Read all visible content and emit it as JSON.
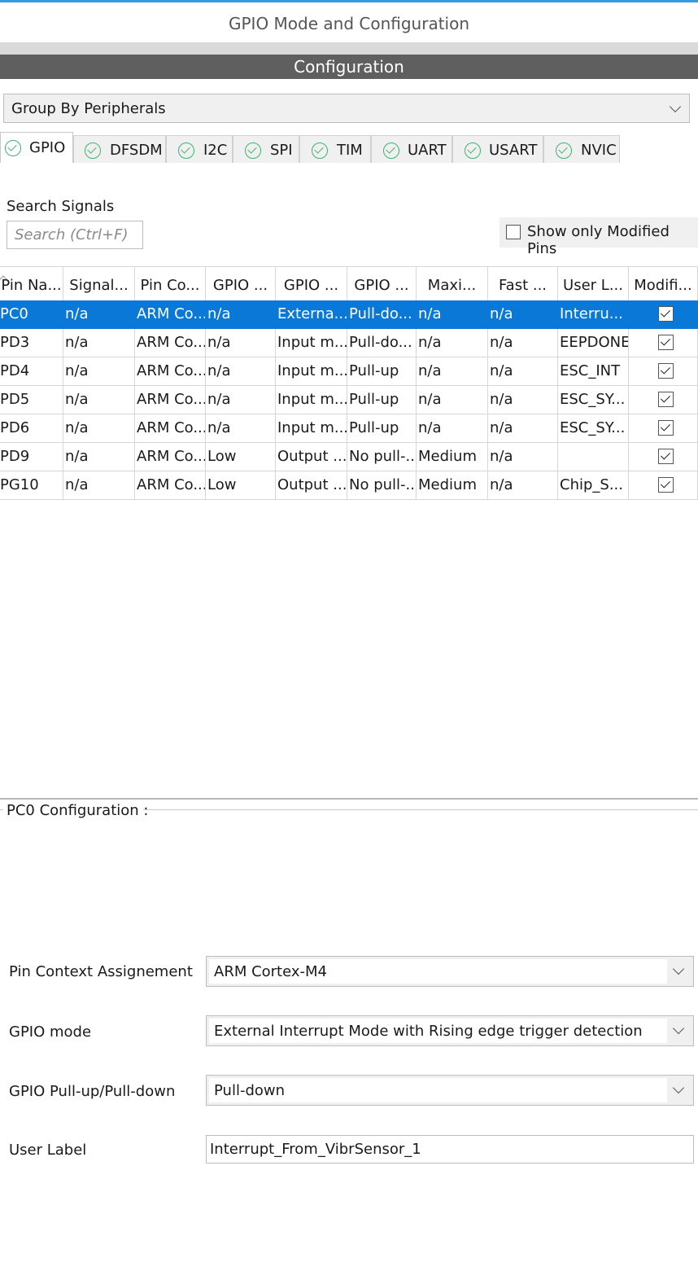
{
  "window": {
    "title": "GPIO Mode and Configuration"
  },
  "section": {
    "title": "Configuration"
  },
  "group_select": {
    "value": "Group By Peripherals"
  },
  "tabs": [
    {
      "label": "GPIO",
      "active": true,
      "icon": "check-circle-icon"
    },
    {
      "label": "DFSDM",
      "active": false,
      "icon": "check-circle-icon"
    },
    {
      "label": "I2C",
      "active": false,
      "icon": "check-circle-icon"
    },
    {
      "label": "SPI",
      "active": false,
      "icon": "check-circle-icon"
    },
    {
      "label": "TIM",
      "active": false,
      "icon": "check-circle-icon"
    },
    {
      "label": "UART",
      "active": false,
      "icon": "check-circle-icon"
    },
    {
      "label": "USART",
      "active": false,
      "icon": "check-circle-icon"
    },
    {
      "label": "NVIC",
      "active": false,
      "icon": "check-circle-icon"
    }
  ],
  "search": {
    "label": "Search Signals",
    "placeholder": "Search (Ctrl+F)",
    "value": ""
  },
  "modified_filter": {
    "label": "Show only Modified Pins",
    "checked": false
  },
  "table": {
    "columns": [
      "Pin Na...",
      "Signal...",
      "Pin Co...",
      "GPIO ...",
      "GPIO ...",
      "GPIO ...",
      "Maxi...",
      "Fast ...",
      "User L...",
      "Modifi..."
    ],
    "rows": [
      {
        "selected": true,
        "cells": [
          "PC0",
          "n/a",
          "ARM Co...",
          "n/a",
          "Externa...",
          "Pull-do...",
          "n/a",
          "n/a",
          "Interru..."
        ],
        "modified": true
      },
      {
        "selected": false,
        "cells": [
          "PD3",
          "n/a",
          "ARM Co...",
          "n/a",
          "Input m...",
          "Pull-do...",
          "n/a",
          "n/a",
          "EEPDONE"
        ],
        "modified": true
      },
      {
        "selected": false,
        "cells": [
          "PD4",
          "n/a",
          "ARM Co...",
          "n/a",
          "Input m...",
          "Pull-up",
          "n/a",
          "n/a",
          "ESC_INT"
        ],
        "modified": true
      },
      {
        "selected": false,
        "cells": [
          "PD5",
          "n/a",
          "ARM Co...",
          "n/a",
          "Input m...",
          "Pull-up",
          "n/a",
          "n/a",
          "ESC_SY..."
        ],
        "modified": true
      },
      {
        "selected": false,
        "cells": [
          "PD6",
          "n/a",
          "ARM Co...",
          "n/a",
          "Input m...",
          "Pull-up",
          "n/a",
          "n/a",
          "ESC_SY..."
        ],
        "modified": true
      },
      {
        "selected": false,
        "cells": [
          "PD9",
          "n/a",
          "ARM Co...",
          "Low",
          "Output ...",
          "No pull-...",
          "Medium",
          "n/a",
          ""
        ],
        "modified": true
      },
      {
        "selected": false,
        "cells": [
          "PG10",
          "n/a",
          "ARM Co...",
          "Low",
          "Output ...",
          "No pull-...",
          "Medium",
          "n/a",
          "Chip_S..."
        ],
        "modified": true
      }
    ]
  },
  "config": {
    "legend": "PC0 Configuration :",
    "pin_context": {
      "label": "Pin Context Assignement",
      "value": "ARM Cortex-M4"
    },
    "gpio_mode": {
      "label": "GPIO mode",
      "value": "External Interrupt Mode with Rising edge trigger detection"
    },
    "gpio_pull": {
      "label": "GPIO Pull-up/Pull-down",
      "value": "Pull-down"
    },
    "user_label": {
      "label": "User Label",
      "value": "Interrupt_From_VibrSensor_1"
    }
  }
}
